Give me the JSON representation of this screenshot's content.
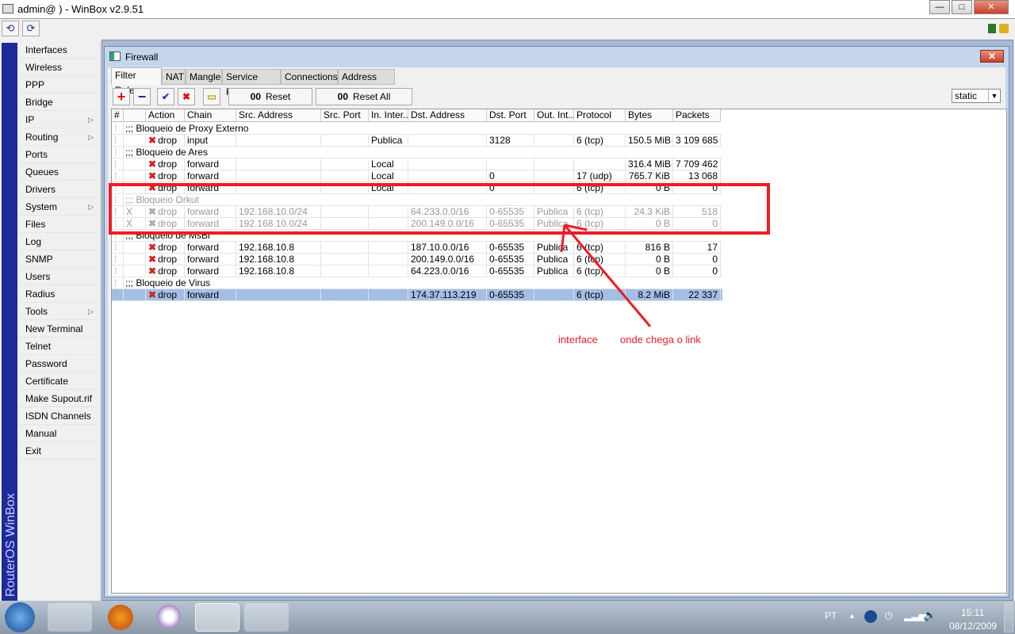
{
  "window": {
    "title": "admin@                        ) - WinBox v2.9.51",
    "minimize": "—",
    "maximize": "□",
    "close": "✕"
  },
  "toolbar": {
    "undo": "⟲",
    "redo": "⟳"
  },
  "vertical_brand": "RouterOS WinBox",
  "sidebar": [
    {
      "label": "Interfaces"
    },
    {
      "label": "Wireless"
    },
    {
      "label": "PPP"
    },
    {
      "label": "Bridge"
    },
    {
      "label": "IP",
      "sub": true
    },
    {
      "label": "Routing",
      "sub": true
    },
    {
      "label": "Ports"
    },
    {
      "label": "Queues"
    },
    {
      "label": "Drivers"
    },
    {
      "label": "System",
      "sub": true
    },
    {
      "label": "Files"
    },
    {
      "label": "Log"
    },
    {
      "label": "SNMP"
    },
    {
      "label": "Users"
    },
    {
      "label": "Radius"
    },
    {
      "label": "Tools",
      "sub": true
    },
    {
      "label": "New Terminal"
    },
    {
      "label": "Telnet"
    },
    {
      "label": "Password"
    },
    {
      "label": "Certificate"
    },
    {
      "label": "Make Supout.rif"
    },
    {
      "label": "ISDN Channels"
    },
    {
      "label": "Manual"
    },
    {
      "label": "Exit"
    }
  ],
  "firewall": {
    "title": "Firewall",
    "close": "✕",
    "tabs": [
      "Filter Rules",
      "NAT",
      "Mangle",
      "Service Ports",
      "Connections",
      "Address Lists"
    ],
    "buttons": {
      "add": "+",
      "remove": "−",
      "enable": "✔",
      "disable": "✖",
      "comment": "▭",
      "reset": "Reset Counters",
      "reset_all": "Reset All Counters",
      "oo": "00"
    },
    "filter": "static",
    "columns": [
      "#",
      "",
      "Action",
      "Chain",
      "Src. Address",
      "Src. Port",
      "In. Inter...",
      "Dst. Address",
      "Dst. Port",
      "Out. Int...",
      "Protocol",
      "Bytes",
      "Packets"
    ],
    "rows": [
      {
        "comment": ";;; Bloqueio de Proxy Externo"
      },
      {
        "action": "drop",
        "chain": "input",
        "in": "Publica",
        "dport": "3128",
        "proto": "6 (tcp)",
        "bytes": "150.5 MiB",
        "packets": "3 109 685"
      },
      {
        "comment": ";;; Bloqueio de Ares"
      },
      {
        "action": "drop",
        "chain": "forward",
        "in": "Local",
        "bytes": "316.4 MiB",
        "packets": "7 709 462"
      },
      {
        "action": "drop",
        "chain": "forward",
        "in": "Local",
        "dport": "0",
        "proto": "17 (udp)",
        "bytes": "765.7 KiB",
        "packets": "13 068"
      },
      {
        "action": "drop",
        "chain": "forward",
        "in": "Local",
        "dport": "0",
        "proto": "6 (tcp)",
        "bytes": "0 B",
        "packets": "0"
      },
      {
        "comment": ";;; Bloqueio Orkut",
        "disabled": true
      },
      {
        "flag": "X",
        "disabled": true,
        "action": "drop",
        "chain": "forward",
        "src": "192.168.10.0/24",
        "dst": "64.233.0.0/16",
        "dport": "0-65535",
        "out": "Publica",
        "proto": "6 (tcp)",
        "bytes": "24.3 KiB",
        "packets": "518"
      },
      {
        "flag": "X",
        "disabled": true,
        "action": "drop",
        "chain": "forward",
        "src": "192.168.10.0/24",
        "dst": "200.149.0.0/16",
        "dport": "0-65535",
        "out": "Publica",
        "proto": "6 (tcp)",
        "bytes": "0 B",
        "packets": "0"
      },
      {
        "comment": ";;; Bloqueio de MsBr"
      },
      {
        "action": "drop",
        "chain": "forward",
        "src": "192.168.10.8",
        "dst": "187.10.0.0/16",
        "dport": "0-65535",
        "out": "Publica",
        "proto": "6 (tcp)",
        "bytes": "816 B",
        "packets": "17"
      },
      {
        "action": "drop",
        "chain": "forward",
        "src": "192.168.10.8",
        "dst": "200.149.0.0/16",
        "dport": "0-65535",
        "out": "Publica",
        "proto": "6 (tcp)",
        "bytes": "0 B",
        "packets": "0"
      },
      {
        "action": "drop",
        "chain": "forward",
        "src": "192.168.10.8",
        "dst": "64.223.0.0/16",
        "dport": "0-65535",
        "out": "Publica",
        "proto": "6 (tcp)",
        "bytes": "0 B",
        "packets": "0"
      },
      {
        "comment": ";;; Bloqueio de Virus"
      },
      {
        "selected": true,
        "action": "drop",
        "chain": "forward",
        "dst": "174.37.113.219",
        "dport": "0-65535",
        "proto": "6 (tcp)",
        "bytes": "8.2 MiB",
        "packets": "22 337"
      }
    ]
  },
  "annotations": {
    "interface": "interface",
    "link": "onde chega o link"
  },
  "tray": {
    "lang": "PT",
    "time": "15:11",
    "date": "08/12/2009"
  }
}
